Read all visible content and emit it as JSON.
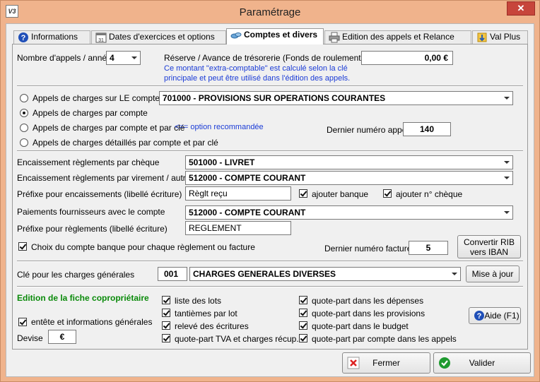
{
  "window": {
    "title": "Paramétrage",
    "close_glyph": "✕",
    "app_icon_text": "V3"
  },
  "tabs": [
    {
      "label": "Informations",
      "icon": "help-icon"
    },
    {
      "label": "Dates d'exercices et options",
      "icon": "calendar-icon"
    },
    {
      "label": "Comptes et divers",
      "icon": "accounts-icon",
      "active": true
    },
    {
      "label": "Edition des appels et Relance",
      "icon": "printer-icon"
    },
    {
      "label": "Val Plus",
      "icon": "val-plus-icon"
    }
  ],
  "section_appels": {
    "nb_appels_label": "Nombre d'appels / année",
    "nb_appels_value": "4",
    "reserve_label": "Réserve / Avance de trésorerie (Fonds de roulement)",
    "reserve_value": "0,00 €",
    "reserve_note_1": "Ce montant \"extra-comptable\" est calculé selon la clé",
    "reserve_note_2": "principale et peut être utilisé dans l'édition des appels."
  },
  "section_mode": {
    "radio_le_compte": "Appels de charges sur LE compte",
    "le_compte_value": "701000 - PROVISIONS SUR OPERATIONS COURANTES",
    "radio_par_compte": "Appels de charges par compte",
    "radio_par_compte_cle": "Appels de charges par compte et par clé",
    "recommended_note": "<== option recommandée",
    "radio_detailles": "Appels de charges détaillés par compte et par clé",
    "selected": "par_compte",
    "dernier_appel_label": "Dernier numéro appel",
    "dernier_appel_value": "140"
  },
  "section_encaissement": {
    "cheque_label": "Encaissement règlements par chèque",
    "cheque_value": "501000 - LIVRET",
    "virement_label": "Encaissement règlements par virement / autre",
    "virement_value": "512000 - COMPTE COURANT",
    "prefixe_label": "Préfixe pour encaissements (libellé écriture)",
    "prefixe_value": "Règlt reçu",
    "ajouter_banque": "ajouter banque",
    "ajouter_cheque": "ajouter n° chèque",
    "fournisseurs_label": "Paiements fournisseurs avec le compte",
    "fournisseurs_value": "512000 - COMPTE COURANT",
    "prefixe_reglements_label": "Préfixe pour règlements (libellé écriture)",
    "prefixe_reglements_value": "REGLEMENT",
    "choix_banque": "Choix du compte banque pour chaque règlement ou facture",
    "derniere_facture_label": "Dernier numéro facture",
    "derniere_facture_value": "5",
    "convertir_rib_1": "Convertir RIB",
    "convertir_rib_2": "vers IBAN"
  },
  "section_cle": {
    "label": "Clé pour les charges générales",
    "code": "001",
    "value": "CHARGES GENERALES DIVERSES",
    "mise_a_jour": "Mise à jour"
  },
  "section_edition": {
    "title": "Edition de la fiche copropriétaire",
    "entete": "entête et informations générales",
    "devise_label": "Devise",
    "devise_value": "€",
    "col1": [
      "liste des lots",
      "tantièmes par lot",
      "relevé des écritures",
      "quote-part TVA et charges récup."
    ],
    "col2": [
      "quote-part dans les dépenses",
      "quote-part dans les provisions",
      "quote-part dans le budget",
      "quote-part par compte dans les appels"
    ],
    "aide": "Aide (F1)"
  },
  "footer": {
    "fermer": "Fermer",
    "valider": "Valider"
  },
  "colors": {
    "window_frame": "#f0b38c",
    "close": "#c7453b",
    "note_blue": "#1a3bd6",
    "section_green": "#0a8a0a"
  }
}
